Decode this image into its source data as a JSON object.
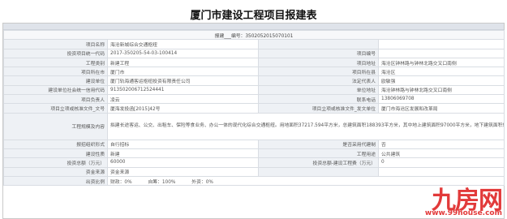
{
  "title": "厦门市建设工程项目报建表",
  "header_row": "报建___编号：3502052015070101",
  "rows": [
    {
      "l1": "项目名称",
      "v1": "海沧新城综合交通枢纽",
      "l2": "",
      "v2": ""
    },
    {
      "l1": "投资项目统一代码",
      "v1": "2017-350205-54-03-100414",
      "l2": "项目编号",
      "v2": ""
    },
    {
      "l1": "工程类别",
      "v1": "新建工程",
      "l2": "项目地址",
      "v2": "海沧区钟林路与钟林北路交叉口南侧"
    },
    {
      "l1": "项目所在市",
      "v1": "厦门市",
      "l2": "项目所在县",
      "v2": "海沧区"
    },
    {
      "l1": "建设单位",
      "v1": "厦门轨海通客运枢纽投资有限责任公司",
      "l2": "法定代表人",
      "v2": "欧敏强"
    },
    {
      "l1": "建设单位社会统一信用代码",
      "v1": "913502006712524441",
      "l2": "单位地址",
      "v2": "海沧钟林路与钟林北路交叉口南侧"
    },
    {
      "l1": "项目负责人",
      "v1": "凌云",
      "l2": "联系电话",
      "v2": "13806069708"
    },
    {
      "l1": "项目立项或核准文件_文号",
      "v1": "厦海发投函[2015]42号",
      "l2": "项目立项或核准文件_发文单位",
      "v2": "厦门市海沧区发展和改革局"
    }
  ],
  "scale": {
    "label": "工程规模及内容",
    "text": "拟建长途客运、公交、出租车、保险等食业务、办公一体的现代化综合交通枢纽。用地面积37217.594平方米，总建筑面积188393平方米，其中地上建筑面积97000平方米，地下建筑面积91393平方米。"
  },
  "rows2": [
    {
      "l1": "报招组织形式",
      "v1": "自行招标",
      "l2": "是否采用代建制",
      "v2": "否"
    },
    {
      "l1": "建设性质",
      "v1": "新建",
      "l2": "工程用途",
      "v2": "公共建筑"
    },
    {
      "l1": "投资总额（万元）",
      "v1": "60000",
      "l2": "投资总额-建设工程费（万元）",
      "v2": "0"
    },
    {
      "l1": "资金来源",
      "v1": "资金来源",
      "l2": "",
      "v2": ""
    }
  ],
  "funding": {
    "label": "出资比例",
    "items": [
      {
        "name": "财政：",
        "pct": "0%"
      },
      {
        "name": "自筹：",
        "pct": "100%"
      },
      {
        "name": "外资：",
        "pct": "0%"
      }
    ]
  },
  "watermark": {
    "main": "九房网",
    "sub": "www.99house.com"
  },
  "colors": {
    "label_bg": "#eef1f5",
    "border": "#d9dde3",
    "watermark": "#e23a3a"
  }
}
